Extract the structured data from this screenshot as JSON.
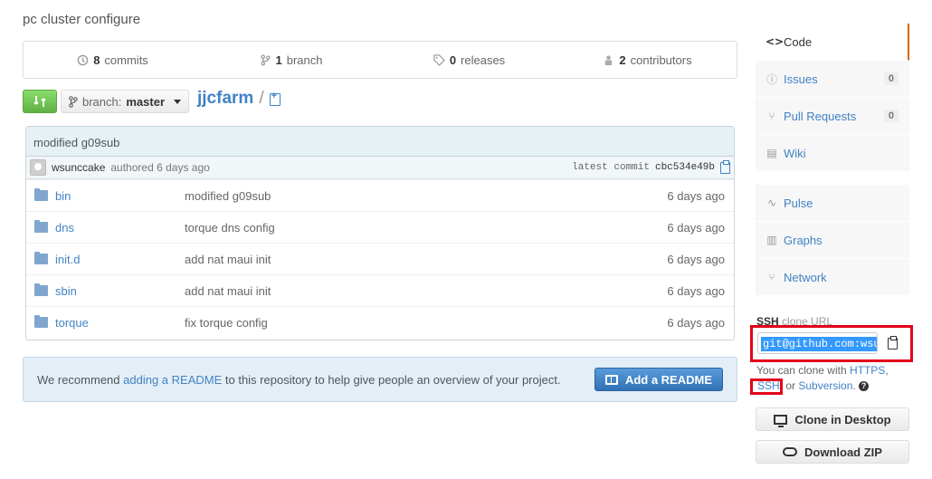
{
  "repo": {
    "description": "pc cluster configure",
    "name": "jjcfarm",
    "path_separator": "/"
  },
  "stats": {
    "commits_count": "8",
    "commits_label": "commits",
    "branch_count": "1",
    "branch_label": "branch",
    "releases_count": "0",
    "releases_label": "releases",
    "contributors_count": "2",
    "contributors_label": "contributors"
  },
  "branch": {
    "prefix": "branch:",
    "name": "master"
  },
  "latest_commit": {
    "message": "modified g09sub",
    "author": "wsunccake",
    "authored_text": "authored 6 days ago",
    "label": "latest commit",
    "sha": "cbc534e49b"
  },
  "files": [
    {
      "name": "bin",
      "message": "modified g09sub",
      "age": "6 days ago"
    },
    {
      "name": "dns",
      "message": "torque dns config",
      "age": "6 days ago"
    },
    {
      "name": "init.d",
      "message": "add nat maui init",
      "age": "6 days ago"
    },
    {
      "name": "sbin",
      "message": "add nat maui init",
      "age": "6 days ago"
    },
    {
      "name": "torque",
      "message": "fix torque config",
      "age": "6 days ago"
    }
  ],
  "readme": {
    "text_before": "We recommend ",
    "link": "adding a README",
    "text_after": " to this repository to help give people an overview of your project.",
    "button": "Add a README"
  },
  "sidebar": {
    "items": [
      {
        "label": "Code",
        "icon": "code-icon",
        "glyph": "<>"
      },
      {
        "label": "Issues",
        "icon": "issue-icon",
        "glyph": "ⓘ",
        "count": "0"
      },
      {
        "label": "Pull Requests",
        "icon": "pull-request-icon",
        "glyph": "⑂",
        "count": "0"
      },
      {
        "label": "Wiki",
        "icon": "book-icon",
        "glyph": "▤"
      },
      {
        "label": "Pulse",
        "icon": "pulse-icon",
        "glyph": "∿"
      },
      {
        "label": "Graphs",
        "icon": "graph-icon",
        "glyph": "▥"
      },
      {
        "label": "Network",
        "icon": "network-icon",
        "glyph": "⑂"
      }
    ]
  },
  "clone": {
    "protocol": "SSH",
    "label_suffix": " clone URL",
    "url": "git@github.com:wsu",
    "help_prefix": "You can clone with ",
    "https": "HTTPS",
    "comma": ",",
    "ssh": "SSH",
    "or": ", or ",
    "subversion": "Subversion",
    "period": ".",
    "help_mark": "?"
  },
  "buttons": {
    "clone_desktop": "Clone in Desktop",
    "download_zip": "Download ZIP"
  },
  "colors": {
    "link": "#4183c4",
    "compare_green": "#60b044",
    "highlight_red": "#e2001a",
    "selected_nav_border": "#d26911"
  }
}
